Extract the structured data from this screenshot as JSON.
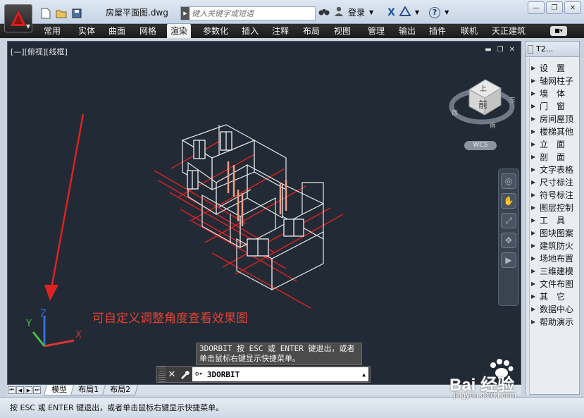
{
  "title_bar": {
    "document_title": "房屋平面图.dwg",
    "search_placeholder": "键入关键字或短语",
    "sign_in": "登录",
    "help": "?"
  },
  "ribbon": {
    "tabs": [
      "常用",
      "实体",
      "曲面",
      "网格",
      "渲染",
      "参数化",
      "插入",
      "注释",
      "布局",
      "视图",
      "管理",
      "输出",
      "插件",
      "联机",
      "天正建筑"
    ],
    "active_tab": "渲染"
  },
  "viewport": {
    "label": "[—][俯视][线框]",
    "annotation": "可自定义调整角度查看效果图",
    "wcs": "WCS",
    "viewcube": {
      "face": "前",
      "top": "上",
      "south": "南",
      "west": "西",
      "east": "东"
    },
    "ucs_axes": {
      "x": "X",
      "y": "Y",
      "z": "Z"
    },
    "colors": {
      "background": "#222a35",
      "model": "#e8e8e8",
      "grid": "#dd2222",
      "annotation": "#e44033",
      "doors": "#e9a08a"
    }
  },
  "command": {
    "tooltip": "3DORBIT 按 ESC 或 ENTER 键退出，或者单击鼠标右键显示快捷菜单。",
    "current": "3DORBIT"
  },
  "layout_tabs": [
    "模型",
    "布局1",
    "布局2"
  ],
  "status_message": "按 ESC 或 ENTER 键退出，或者单击鼠标右键显示快捷菜单。",
  "palette": {
    "title": "T2...",
    "items": [
      "设　置",
      "轴网柱子",
      "墙　体",
      "门　窗",
      "房间屋顶",
      "楼梯其他",
      "立　面",
      "剖　面",
      "文字表格",
      "尺寸标注",
      "符号标注",
      "图层控制",
      "工　具",
      "图块图案",
      "建筑防火",
      "场地布置",
      "三维建模",
      "文件布图",
      "其　它",
      "数据中心",
      "帮助演示"
    ]
  },
  "watermark": {
    "brand": "Bai 经验",
    "url": "jingyan.baidu.com"
  }
}
